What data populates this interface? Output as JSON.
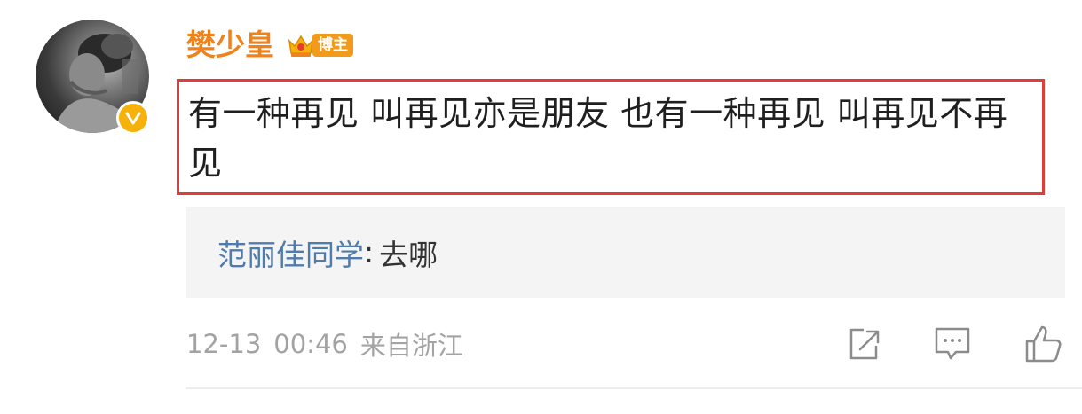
{
  "comment": {
    "author": {
      "name": "樊少皇",
      "badge_label": "博主",
      "verified_color": "#f6b20a",
      "name_color": "#f08219"
    },
    "content": "有一种再见 叫再见亦是朋友 也有一种再见 叫再见不再见",
    "highlight_color": "#e23b38",
    "reply": {
      "author": "范丽佳同学",
      "separator": ":",
      "text": "去哪"
    },
    "meta": {
      "date": "12-13",
      "time": "00:46",
      "source": "来自浙江"
    },
    "actions": [
      {
        "icon": "share-icon"
      },
      {
        "icon": "comment-icon"
      },
      {
        "icon": "like-icon"
      }
    ]
  }
}
